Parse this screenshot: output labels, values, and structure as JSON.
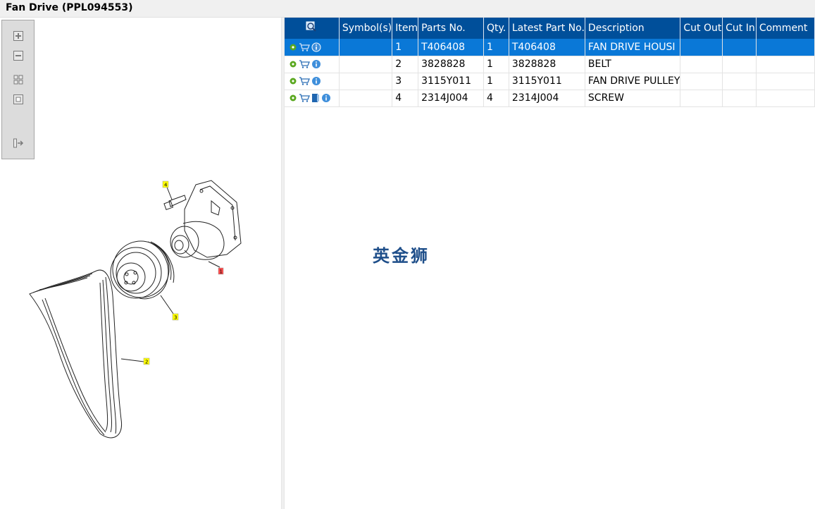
{
  "window": {
    "title": "Fan Drive (PPL094553)"
  },
  "toolbar": {
    "buttons": [
      {
        "name": "zoom-in",
        "icon": "zoom-in-icon"
      },
      {
        "name": "zoom-out",
        "icon": "zoom-out-icon"
      },
      {
        "name": "fit-all",
        "icon": "fit-all-icon"
      },
      {
        "name": "actual-size",
        "icon": "actual-size-icon"
      },
      {
        "name": "export",
        "icon": "export-icon"
      }
    ]
  },
  "drawing": {
    "callouts": [
      "1",
      "2",
      "3",
      "4"
    ],
    "highlight_colors": {
      "selected": "#ff4b4b",
      "normal": "#ffff00"
    }
  },
  "parts_table": {
    "columns": [
      "Symbol(s)",
      "Item",
      "Parts No.",
      "Qty.",
      "Latest Part No.",
      "Description",
      "Cut Out",
      "Cut In",
      "Comment"
    ],
    "rows": [
      {
        "item": "1",
        "part_no": "T406408",
        "qty": "1",
        "latest": "T406408",
        "description": "FAN DRIVE HOUSI",
        "icons": [
          "gear-icon",
          "cart-icon",
          "info-icon"
        ],
        "selected": true
      },
      {
        "item": "2",
        "part_no": "3828828",
        "qty": "1",
        "latest": "3828828",
        "description": "BELT",
        "icons": [
          "gear-icon",
          "cart-icon",
          "info-icon"
        ],
        "selected": false
      },
      {
        "item": "3",
        "part_no": "3115Y011",
        "qty": "1",
        "latest": "3115Y011",
        "description": "FAN DRIVE PULLEY",
        "icons": [
          "gear-icon",
          "cart-icon",
          "info-icon"
        ],
        "selected": false
      },
      {
        "item": "4",
        "part_no": "2314J004",
        "qty": "4",
        "latest": "2314J004",
        "description": "SCREW",
        "icons": [
          "gear-icon",
          "cart-icon",
          "book-icon",
          "info-icon"
        ],
        "selected": false
      }
    ]
  },
  "watermark": "英金狮",
  "colors": {
    "header": "#004f9a",
    "selected_row": "#0a78d7"
  }
}
